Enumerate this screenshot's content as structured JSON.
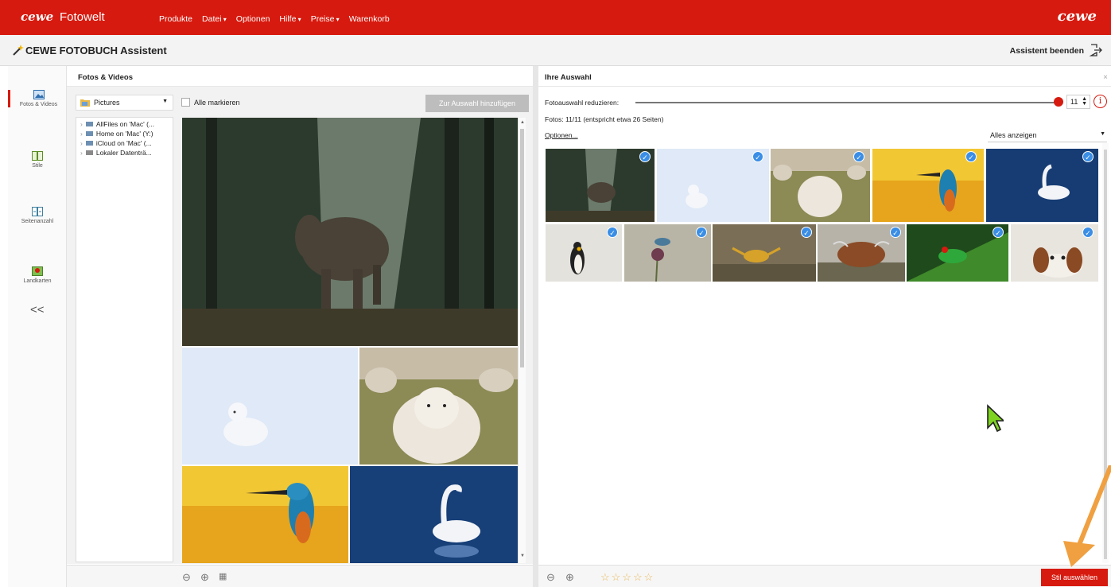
{
  "app": {
    "logo": "cewe",
    "logo_sub": "Fotowelt",
    "logo_right": "cewe",
    "menu": [
      "Produkte",
      "Datei",
      "Optionen",
      "Hilfe",
      "Preise",
      "Warenkorb"
    ]
  },
  "titlebar": {
    "title": "CEWE FOTOBUCH Assistent",
    "exit_label": "Assistent beenden"
  },
  "nav": {
    "items": [
      {
        "label": "Fotos & Videos",
        "icon": "photo-icon",
        "active": true
      },
      {
        "label": "Stile",
        "icon": "styles-icon",
        "active": false
      },
      {
        "label": "Seitenanzahl",
        "icon": "pages-icon",
        "active": false
      },
      {
        "label": "Landkarten",
        "icon": "map-icon",
        "active": false
      }
    ],
    "collapse": "<<"
  },
  "left_panel": {
    "title": "Fotos & Videos",
    "folder": "Pictures",
    "mark_all": "Alle markieren",
    "add_button": "Zur Auswahl hinzufügen",
    "tree": [
      "AllFiles on 'Mac' (...",
      "Home on 'Mac' (Y:)",
      "iCloud on 'Mac' (...",
      "Lokaler Datenträ..."
    ]
  },
  "right_panel": {
    "title": "Ihre Auswahl",
    "reduce_label": "Fotoauswahl reduzieren:",
    "reduce_value": "11",
    "count_text": "Fotos: 11/11  (entspricht etwa 26 Seiten)",
    "options_link": "Optionen...",
    "show_select": "Alles anzeigen",
    "style_button": "Stil auswählen",
    "rating_stars": "☆☆☆☆☆"
  },
  "colors": {
    "brand": "#d71a0f",
    "check": "#3a8ee6",
    "disabled_button": "#bdbdbd"
  }
}
